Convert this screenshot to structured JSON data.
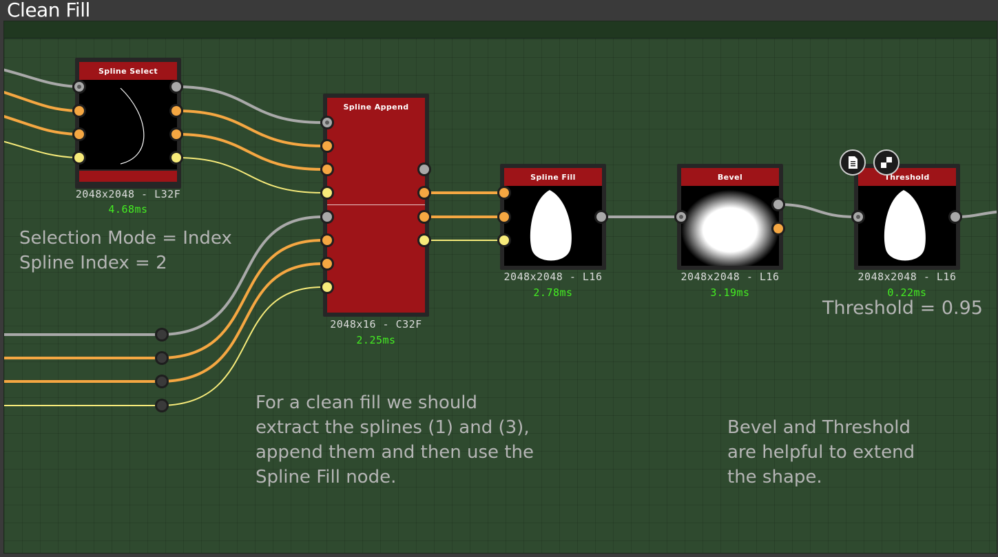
{
  "frame": {
    "title": "Clean Fill"
  },
  "nodes": {
    "spline_select": {
      "title": "Spline Select",
      "resolution": "2048x2048 - L32F",
      "time": "4.68ms"
    },
    "spline_append": {
      "title": "Spline Append",
      "resolution": "2048x16 - C32F",
      "time": "2.25ms"
    },
    "spline_fill": {
      "title": "Spline Fill",
      "resolution": "2048x2048 - L16",
      "time": "2.78ms"
    },
    "bevel": {
      "title": "Bevel",
      "resolution": "2048x2048 - L16",
      "time": "3.19ms"
    },
    "threshold": {
      "title": "Threshold",
      "resolution": "2048x2048 - L16",
      "time": "0.22ms",
      "icons": [
        "document-icon",
        "checker-icon"
      ]
    }
  },
  "annotations": {
    "selection_mode": "Selection Mode = Index",
    "spline_index": "Spline Index = 2",
    "threshold_value": "Threshold = 0.95",
    "clean_fill_note": "For a clean fill we should\nextract the splines (1) and (3),\nappend them and then use the\nSpline Fill node.",
    "bevel_note": "Bevel and Threshold\nare helpful to extend\nthe shape."
  },
  "colors": {
    "frame_bg": "#2f4a2f",
    "node_header": "#9e1418",
    "wire_grey": "#a9a9a9",
    "wire_orange": "#f5a742",
    "wire_yellow": "#f7eb7a",
    "time_text": "#44ee22"
  }
}
